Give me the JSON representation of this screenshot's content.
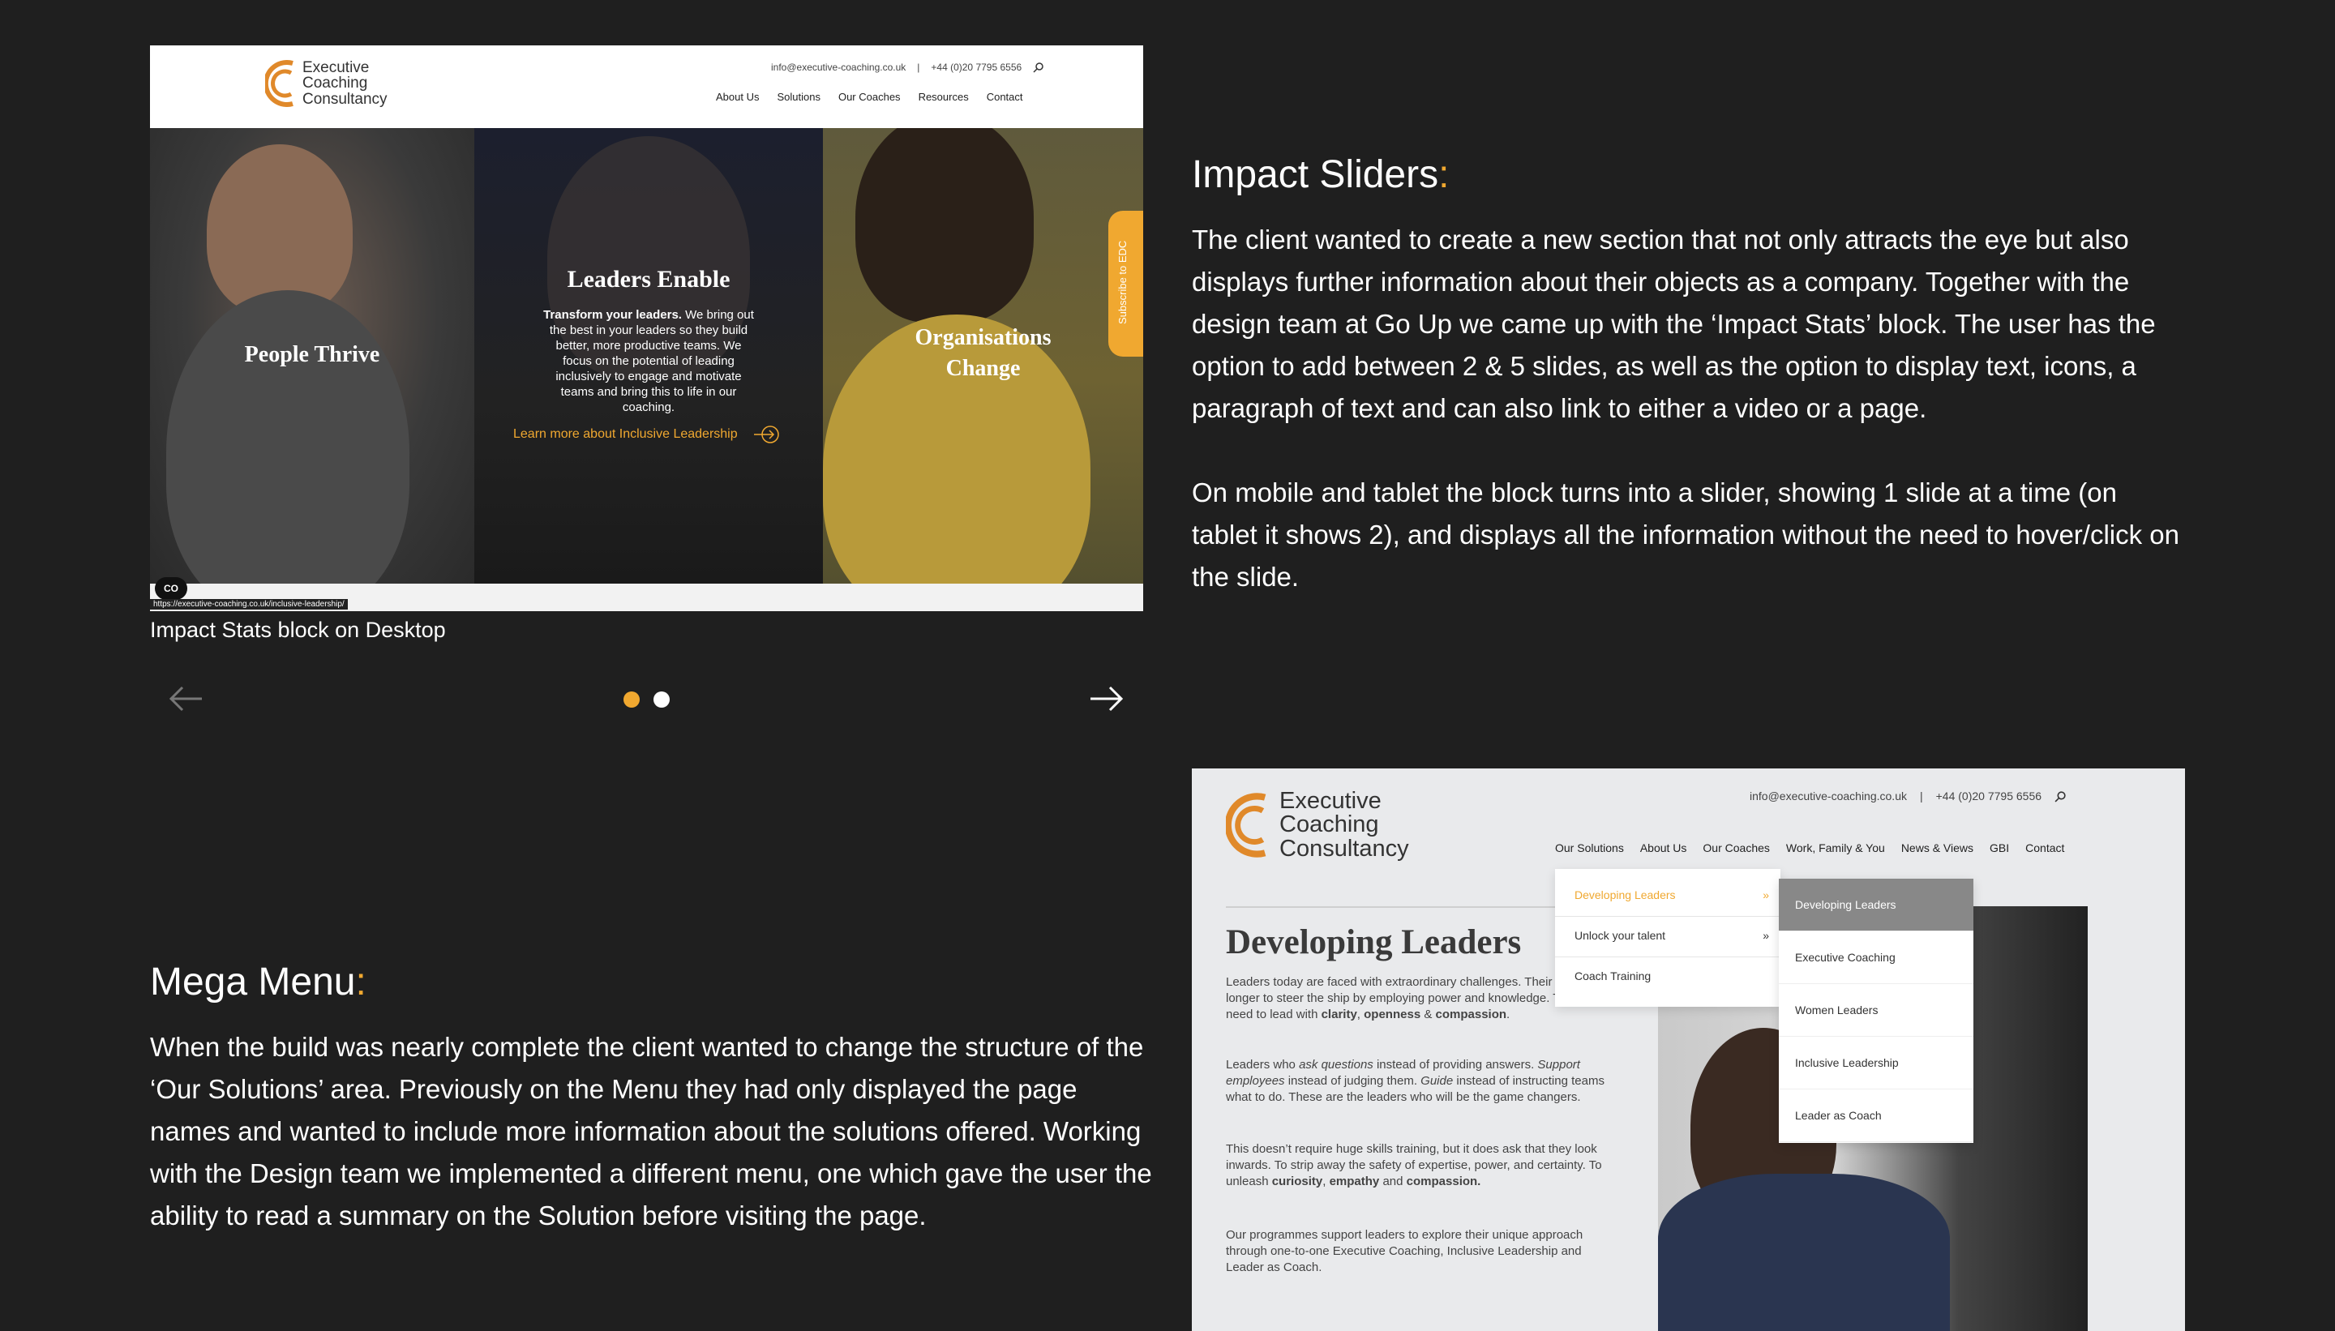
{
  "impact": {
    "title": "Impact Sliders",
    "title_colon": ":",
    "paragraph1": "The client wanted to create a new section that not only attracts the eye but also displays further information about their objects as a company. Together with the design team at Go Up we came up with the ‘Impact Stats’ block. The user has the option to add between 2 & 5 slides, as well as the option to display text, icons, a paragraph of text and can also link to either a video or a page.",
    "paragraph2": "On mobile and tablet the block turns into a slider, showing 1 slide at a time (on tablet it shows 2), and displays all the information without the need to hover/click on the slide."
  },
  "mega": {
    "title": "Mega Menu",
    "title_colon": ":",
    "paragraph": "When the build was nearly complete the client wanted to change the structure of the ‘Our Solutions’ area. Previously on the Menu they had only displayed the page names and wanted to include more information about the solutions offered. Working with the Design team we implemented a different menu, one which gave the user the ability to read a summary on the Solution before visiting the page."
  },
  "shot1": {
    "caption": "Impact Stats block on Desktop",
    "logo_lines": [
      "Executive",
      "Coaching",
      "Consultancy"
    ],
    "email": "info@executive-coaching.co.uk",
    "separator": "|",
    "phone": "+44 (0)20 7795 6556",
    "nav": [
      "About Us",
      "Solutions",
      "Our Coaches",
      "Resources",
      "Contact"
    ],
    "panel1_title": "People Thrive",
    "panel2_title": "Leaders Enable",
    "panel2_body_bold": "Transform your leaders.",
    "panel2_body": " We bring out the best in your leaders so they build better, more productive teams. We focus on the potential of leading inclusively to engage and motivate teams and bring this to life in our coaching.",
    "panel2_link": "Learn more about Inclusive Leadership",
    "panel3_title_1": "Organisations",
    "panel3_title_2": "Change",
    "subscribe": "Subscribe to EDC",
    "url_tooltip": "https://executive-coaching.co.uk/inclusive-leadership/",
    "badge": "CO"
  },
  "carousel": {
    "active_index": 0,
    "total": 2,
    "active_color": "#f0a830",
    "inactive_color": "#ffffff"
  },
  "shot2": {
    "logo_lines": [
      "Executive",
      "Coaching",
      "Consultancy"
    ],
    "email": "info@executive-coaching.co.uk",
    "separator": "|",
    "phone": "+44 (0)20 7795 6556",
    "nav": [
      "Our Solutions",
      "About Us",
      "Our Coaches",
      "Work, Family & You",
      "News & Views",
      "GBI",
      "Contact"
    ],
    "page_title": "Developing Leaders",
    "p1_a": "Leaders today are faced with extraordinary challenges. Their role is no longer to steer the ship by employing power and knowledge. They need to lead with ",
    "p1_b": "clarity",
    "p1_c": ", ",
    "p1_d": "openness",
    "p1_e": " & ",
    "p1_f": "compassion",
    "p1_g": ".",
    "p2_a": "Leaders who ",
    "p2_b": "ask questions",
    "p2_c": " instead of providing answers. ",
    "p2_d": "Support employees",
    "p2_e": " instead of judging them. ",
    "p2_f": "Guide",
    "p2_g": " instead of instructing teams what to do. These are the leaders who will be the game changers.",
    "p3_a": "This doesn’t require huge skills training, but it does ask that they look inwards. To strip away the safety of expertise, power, and certainty. To unleash ",
    "p3_b": "curiosity",
    "p3_c": ", ",
    "p3_d": "empathy",
    "p3_e": " and ",
    "p3_f": "compassion.",
    "p4": "Our programmes support leaders to explore their unique approach through one-to-one Executive Coaching, Inclusive Leadership and Leader as Coach.",
    "menu_level1": [
      {
        "label": "Developing Leaders",
        "chevron": "»"
      },
      {
        "label": "Unlock your talent",
        "chevron": "»"
      },
      {
        "label": "Coach Training",
        "chevron": ""
      }
    ],
    "menu_level2": [
      "Developing Leaders",
      "Executive Coaching",
      "Women Leaders",
      "Inclusive Leadership",
      "Leader as Coach"
    ]
  },
  "colors": {
    "accent": "#f0a830",
    "background": "#1f1f1f"
  }
}
